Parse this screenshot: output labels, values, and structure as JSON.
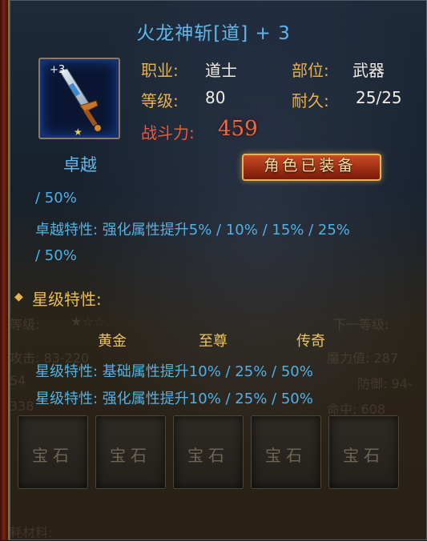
{
  "item": {
    "title": "火龙神斩[道] + 3",
    "enhance_badge": "+3",
    "star_icon": "★",
    "quality": "卓越"
  },
  "stats": {
    "class_label": "职业:",
    "class_value": "道士",
    "slot_label": "部位:",
    "slot_value": "武器",
    "level_label": "等级:",
    "level_value": "80",
    "durability_label": "耐久:",
    "durability_value": "25/25",
    "power_label": "战斗力:",
    "power_value": "459"
  },
  "equipped_badge": "角色已装备",
  "excellence": {
    "line0": "/ 50%",
    "line1": "卓越特性: 强化属性提升5% / 10% / 15% / 25%",
    "line2": "/ 50%"
  },
  "star_section": {
    "title": "星级特性:",
    "tiers": [
      "黄金",
      "至尊",
      "传奇"
    ],
    "line1": "星级特性: 基础属性提升10% / 25% / 50%",
    "line2": "星级特性: 强化属性提升10% / 25% / 50%"
  },
  "gems": [
    "宝石",
    "宝石",
    "宝石",
    "宝石",
    "宝石"
  ],
  "background_ghost_text": {
    "level": "等级:",
    "next_level": "下一等级:",
    "attack": "攻击: 83-220",
    "power": "魔力值: 287",
    "n1": "54",
    "n2": "338",
    "defense": "防御: 94-",
    "hit": "命中: 608",
    "material": "耗材料:"
  },
  "colors": {
    "title": "#5fb7ea",
    "label": "#e9b24a",
    "power": "#ea5a3c",
    "cyan_text": "#4fb2e6"
  }
}
